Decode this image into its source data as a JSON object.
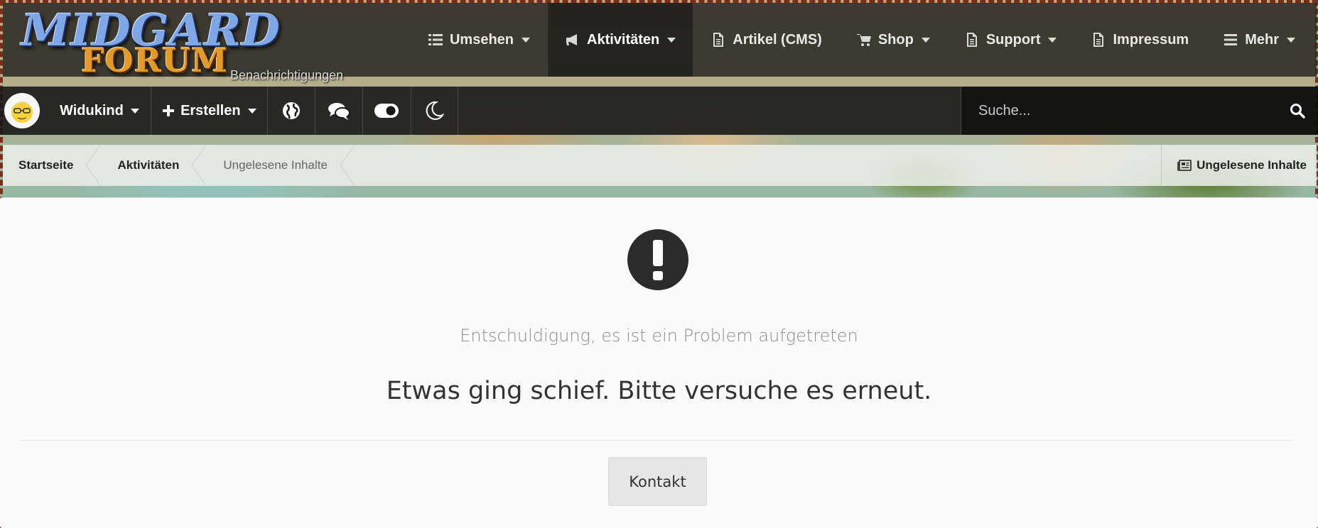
{
  "logo": {
    "line1": "MIDGARD",
    "line2": "FORUM"
  },
  "header": {
    "notifications_label": "Benachrichtigungen"
  },
  "nav": {
    "items": [
      {
        "label": "Umsehen",
        "icon": "list-icon",
        "dropdown": true
      },
      {
        "label": "Aktivitäten",
        "icon": "bullhorn-icon",
        "dropdown": true,
        "active": true
      },
      {
        "label": "Artikel (CMS)",
        "icon": "document-icon",
        "dropdown": false
      },
      {
        "label": "Shop",
        "icon": "cart-icon",
        "dropdown": true
      },
      {
        "label": "Support",
        "icon": "document-icon",
        "dropdown": true
      },
      {
        "label": "Impressum",
        "icon": "document-icon",
        "dropdown": false
      },
      {
        "label": "Mehr",
        "icon": "hamburger-icon",
        "dropdown": true
      }
    ]
  },
  "userbar": {
    "username": "Widukind",
    "create_label": "Erstellen",
    "search_placeholder": "Suche..."
  },
  "breadcrumb": {
    "items": [
      "Startseite",
      "Aktivitäten",
      "Ungelesene Inhalte"
    ],
    "action_label": "Ungelesene Inhalte"
  },
  "error": {
    "subtitle": "Entschuldigung, es ist ein Problem aufgetreten",
    "title": "Etwas ging schief. Bitte versuche es erneut.",
    "contact_button": "Kontakt"
  },
  "colors": {
    "topbar_bg": "#202220",
    "userbar_bg": "#161616",
    "content_bg": "#fafafa",
    "error_icon": "#2b2b2b"
  }
}
